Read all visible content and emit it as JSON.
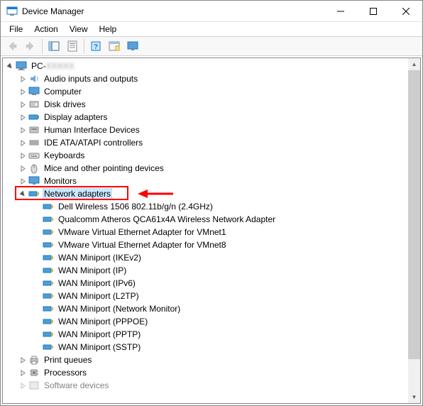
{
  "window": {
    "title": "Device Manager"
  },
  "menus": {
    "file": "File",
    "action": "Action",
    "view": "View",
    "help": "Help"
  },
  "tree": {
    "root": "PC-",
    "cat": {
      "audio": "Audio inputs and outputs",
      "computer": "Computer",
      "disk": "Disk drives",
      "display": "Display adapters",
      "hid": "Human Interface Devices",
      "ide": "IDE ATA/ATAPI controllers",
      "keyboards": "Keyboards",
      "mice": "Mice and other pointing devices",
      "monitors": "Monitors",
      "network": "Network adapters",
      "print": "Print queues",
      "processors": "Processors",
      "software": "Software devices"
    },
    "net": {
      "0": "Dell Wireless 1506 802.11b/g/n (2.4GHz)",
      "1": "Qualcomm Atheros QCA61x4A Wireless Network Adapter",
      "2": "VMware Virtual Ethernet Adapter for VMnet1",
      "3": "VMware Virtual Ethernet Adapter for VMnet8",
      "4": "WAN Miniport (IKEv2)",
      "5": "WAN Miniport (IP)",
      "6": "WAN Miniport (IPv6)",
      "7": "WAN Miniport (L2TP)",
      "8": "WAN Miniport (Network Monitor)",
      "9": "WAN Miniport (PPPOE)",
      "10": "WAN Miniport (PPTP)",
      "11": "WAN Miniport (SSTP)"
    }
  }
}
